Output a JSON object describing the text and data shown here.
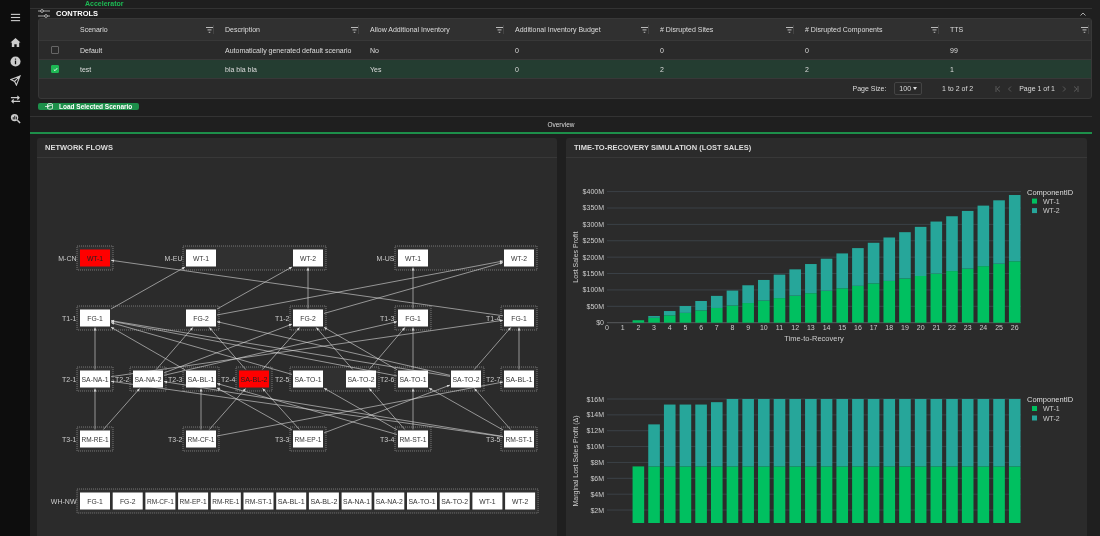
{
  "app": {
    "logo_text": "Accelerator"
  },
  "controls": {
    "title": "CONTROLS",
    "expanded": true,
    "table": {
      "columns": [
        "Scenario",
        "Description",
        "Allow Additional Inventory",
        "Additional Inventory Budget",
        "# Disrupted Sites",
        "# Disrupted Components",
        "TTS"
      ],
      "rows": [
        {
          "selected": false,
          "cells": [
            "Default",
            "Automatically generated default scenario",
            "No",
            "0",
            "0",
            "0",
            "99"
          ]
        },
        {
          "selected": true,
          "cells": [
            "test",
            "bla bla bla",
            "Yes",
            "0",
            "2",
            "2",
            "1"
          ]
        }
      ],
      "pagination": {
        "page_size_label": "Page Size:",
        "page_size": "100",
        "range": "1 to 2 of 2",
        "page": "Page 1 of 1"
      }
    },
    "load_button": "Load Selected Scenario"
  },
  "tabs": [
    {
      "label": "Overview",
      "selected": true
    }
  ],
  "network_flows": {
    "title": "NETWORK FLOWS",
    "tiers": [
      {
        "groups": [
          {
            "label": "M-CN",
            "nodes": [
              {
                "label": "WT-1",
                "disrupted": true
              }
            ]
          },
          {
            "label": "M-EU",
            "nodes": [
              {
                "label": "WT-1",
                "disrupted": false
              },
              {
                "label": "WT-2",
                "disrupted": false
              }
            ]
          },
          {
            "label": "M-US",
            "nodes": [
              {
                "label": "WT-1",
                "disrupted": false
              },
              {
                "label": "WT-2",
                "disrupted": false
              }
            ]
          }
        ]
      },
      {
        "groups": [
          {
            "label": "T1-1",
            "nodes": [
              {
                "label": "FG-1",
                "disrupted": false
              },
              {
                "label": "FG-2",
                "disrupted": false
              }
            ]
          },
          {
            "label": "T1-2",
            "nodes": [
              {
                "label": "FG-2",
                "disrupted": false
              }
            ]
          },
          {
            "label": "T1-3",
            "nodes": [
              {
                "label": "FG-1",
                "disrupted": false
              }
            ]
          },
          {
            "label": "T1-4",
            "nodes": [
              {
                "label": "FG-1",
                "disrupted": false
              }
            ]
          }
        ]
      },
      {
        "groups": [
          {
            "label": "T2-1",
            "nodes": [
              {
                "label": "SA-NA-1",
                "disrupted": false
              }
            ]
          },
          {
            "label": "T2-2",
            "nodes": [
              {
                "label": "SA-NA-2",
                "disrupted": false
              }
            ]
          },
          {
            "label": "T2-3",
            "nodes": [
              {
                "label": "SA-BL-1",
                "disrupted": false
              }
            ]
          },
          {
            "label": "T2-4",
            "nodes": [
              {
                "label": "SA-BL-2",
                "disrupted": true
              }
            ]
          },
          {
            "label": "T2-5",
            "nodes": [
              {
                "label": "SA-TO-1",
                "disrupted": false
              },
              {
                "label": "SA-TO-2",
                "disrupted": false
              }
            ]
          },
          {
            "label": "T2-6",
            "nodes": [
              {
                "label": "SA-TO-1",
                "disrupted": false
              },
              {
                "label": "SA-TO-2",
                "disrupted": false
              }
            ]
          },
          {
            "label": "T2-7",
            "nodes": [
              {
                "label": "SA-BL-1",
                "disrupted": false
              }
            ]
          }
        ]
      },
      {
        "groups": [
          {
            "label": "T3-1",
            "nodes": [
              {
                "label": "RM-RE-1",
                "disrupted": false
              }
            ]
          },
          {
            "label": "T3-2",
            "nodes": [
              {
                "label": "RM-CF-1",
                "disrupted": false
              }
            ]
          },
          {
            "label": "T3-3",
            "nodes": [
              {
                "label": "RM-EP-1",
                "disrupted": false
              }
            ]
          },
          {
            "label": "T3-4",
            "nodes": [
              {
                "label": "RM-ST-1",
                "disrupted": false
              }
            ]
          },
          {
            "label": "T3-5",
            "nodes": [
              {
                "label": "RM-ST-1",
                "disrupted": false
              }
            ]
          }
        ]
      },
      {
        "groups": [
          {
            "label": "WH-NW",
            "nodes": [
              {
                "label": "FG-1",
                "disrupted": false
              },
              {
                "label": "FG-2",
                "disrupted": false
              },
              {
                "label": "RM-CF-1",
                "disrupted": false
              },
              {
                "label": "RM-EP-1",
                "disrupted": false
              },
              {
                "label": "RM-RE-1",
                "disrupted": false
              },
              {
                "label": "RM-ST-1",
                "disrupted": false
              },
              {
                "label": "SA-BL-1",
                "disrupted": false
              },
              {
                "label": "SA-BL-2",
                "disrupted": false
              },
              {
                "label": "SA-NA-1",
                "disrupted": false
              },
              {
                "label": "SA-NA-2",
                "disrupted": false
              },
              {
                "label": "SA-TO-1",
                "disrupted": false
              },
              {
                "label": "SA-TO-2",
                "disrupted": false
              },
              {
                "label": "WT-1",
                "disrupted": false
              },
              {
                "label": "WT-2",
                "disrupted": false
              }
            ]
          }
        ]
      }
    ]
  },
  "recovery": {
    "title": "TIME-TO-RECOVERY SIMULATION (LOST SALES)",
    "charts": [
      {
        "chart_data": {
          "type": "bar",
          "stacked": true,
          "grid": true,
          "xlabel": "Time-to-Recovery",
          "ylabel": "Lost Sales Profit",
          "legend": {
            "title": "ComponentID"
          },
          "x": [
            1,
            2,
            3,
            4,
            5,
            6,
            7,
            8,
            9,
            10,
            11,
            12,
            13,
            14,
            15,
            16,
            17,
            18,
            19,
            20,
            21,
            22,
            23,
            24,
            25,
            26
          ],
          "xlim": [
            0,
            26.4
          ],
          "xticks": [
            0,
            1,
            2,
            3,
            4,
            5,
            6,
            7,
            8,
            9,
            10,
            11,
            12,
            13,
            14,
            15,
            16,
            17,
            18,
            19,
            20,
            21,
            22,
            23,
            24,
            25,
            26
          ],
          "ylim": [
            0,
            400
          ],
          "yticks": [
            {
              "value": 0,
              "label": "$0"
            },
            {
              "value": 50,
              "label": "$50M"
            },
            {
              "value": 100,
              "label": "$100M"
            },
            {
              "value": 150,
              "label": "$150M"
            },
            {
              "value": 200,
              "label": "$200M"
            },
            {
              "value": 250,
              "label": "$250M"
            },
            {
              "value": 300,
              "label": "$300M"
            },
            {
              "value": 350,
              "label": "$350M"
            },
            {
              "value": 400,
              "label": "$400M"
            }
          ],
          "series": [
            {
              "name": "WT-1",
              "color": "#00c060",
              "values": [
                0,
                7.5,
                15,
                22.5,
                30,
                37.5,
                45,
                52.5,
                60,
                67.5,
                75,
                82.5,
                90,
                97.5,
                105,
                112.5,
                120,
                127.5,
                135,
                142.5,
                150,
                157.5,
                165,
                172.5,
                180,
                187.5
              ]
            },
            {
              "name": "WT-2",
              "color": "#26a69a",
              "values": [
                0,
                0,
                5.3,
                13.1,
                20.9,
                28.7,
                36.8,
                45.5,
                54.2,
                62.9,
                71.6,
                80.3,
                89,
                97.7,
                106.4,
                115.1,
                123.8,
                132.5,
                141.2,
                149.9,
                158.6,
                167.3,
                176,
                184.7,
                193.4,
                202.1
              ]
            }
          ]
        }
      },
      {
        "chart_data": {
          "type": "bar",
          "stacked": true,
          "grid": true,
          "ylabel": "Marginal Lost Sales Profit (Δ)",
          "legend": {
            "title": "ComponentID"
          },
          "ylim": [
            0,
            16
          ],
          "x": [
            2,
            3,
            4,
            5,
            6,
            7,
            8,
            9,
            10,
            11,
            12,
            13,
            14,
            15,
            16,
            17,
            18,
            19,
            20,
            21,
            22,
            23,
            24,
            25,
            26
          ],
          "xlim": [
            0,
            26.4
          ],
          "yticks": [
            {
              "value": 2,
              "label": "$2M"
            },
            {
              "value": 4,
              "label": "$4M"
            },
            {
              "value": 6,
              "label": "$6M"
            },
            {
              "value": 8,
              "label": "$8M"
            },
            {
              "value": 10,
              "label": "$10M"
            },
            {
              "value": 12,
              "label": "$12M"
            },
            {
              "value": 14,
              "label": "$14M"
            },
            {
              "value": 16,
              "label": "$16M"
            }
          ],
          "series": [
            {
              "name": "WT-1",
              "color": "#00c060",
              "values": [
                7.5,
                7.5,
                7.5,
                7.5,
                7.5,
                7.5,
                7.5,
                7.5,
                7.5,
                7.5,
                7.5,
                7.5,
                7.5,
                7.5,
                7.5,
                7.5,
                7.5,
                7.5,
                7.5,
                7.5,
                7.5,
                7.5,
                7.5,
                7.5,
                7.5
              ]
            },
            {
              "name": "WT-2",
              "color": "#26a69a",
              "values": [
                null,
                5.3,
                7.8,
                7.8,
                7.8,
                8.1,
                8.5,
                8.5,
                8.5,
                8.5,
                8.5,
                8.5,
                8.5,
                8.5,
                8.5,
                8.5,
                8.5,
                8.5,
                8.5,
                8.5,
                8.5,
                8.5,
                8.5,
                8.5,
                8.5
              ]
            }
          ]
        }
      }
    ]
  }
}
